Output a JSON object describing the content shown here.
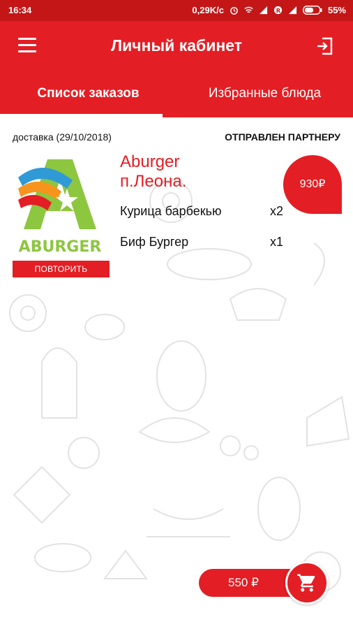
{
  "status_bar": {
    "time": "16:34",
    "network_speed": "0,29K/c",
    "battery": "55%"
  },
  "app_bar": {
    "title": "Личный кабинет",
    "menu_icon": "hamburger-icon",
    "logout_icon": "logout-icon"
  },
  "tabs": [
    {
      "label": "Список заказов",
      "active": true
    },
    {
      "label": "Избранные блюда",
      "active": false
    }
  ],
  "order": {
    "date_label": "доставка (29/10/2018)",
    "status": "ОТПРАВЛЕН ПАРТНЕРУ",
    "restaurant_line1": "Aburger",
    "restaurant_line2": "п.Леона.",
    "logo_text": "ABURGER",
    "price": "930₽",
    "repeat_label": "ПОВТОРИТЬ",
    "items": [
      {
        "name": "Курица барбекью",
        "qty": "x2"
      },
      {
        "name": "Биф Бургер",
        "qty": "x1"
      }
    ]
  },
  "cart": {
    "total": "550 ₽",
    "icon": "shopping-cart-icon"
  },
  "colors": {
    "primary": "#e31e24",
    "status_bar": "#c41617",
    "logo_green": "#8dc63f"
  }
}
